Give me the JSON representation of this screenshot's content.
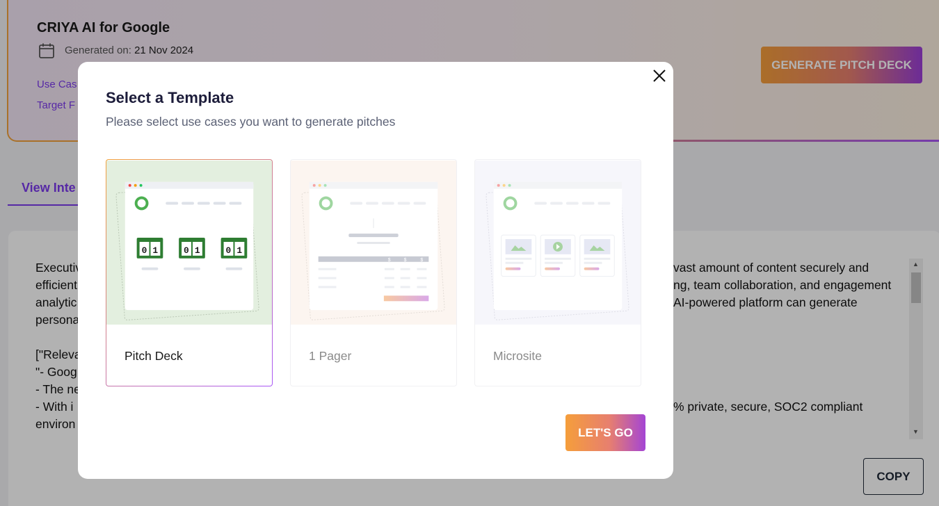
{
  "page": {
    "title": "CRIYA AI for Google",
    "generated_label": "Generated on:",
    "generated_date": "21 Nov 2024",
    "links": [
      "Use Cas",
      "Target F"
    ],
    "generate_button": "GENERATE PITCH DECK",
    "tab_label": "View Inte",
    "copy_button": "COPY",
    "content_lines": [
      {
        "left": "Executiv",
        "right": "vast amount of content securely and"
      },
      {
        "left": "efficient",
        "right": "ng, team collaboration, and engagement"
      },
      {
        "left": "analytic",
        "right": "AI-powered platform can generate"
      },
      {
        "left": "personal",
        "right": ""
      },
      {
        "left": "",
        "right": ""
      },
      {
        "left": "[\"Releva",
        "right": ""
      },
      {
        "left": "\"- Goog",
        "right": ""
      },
      {
        "left": "- The ne",
        "right": ""
      },
      {
        "left": "- With i",
        "right": "% private, secure, SOC2 compliant"
      },
      {
        "left": "environ",
        "right": ""
      }
    ]
  },
  "modal": {
    "title": "Select a Template",
    "subtitle": "Please select use cases you want to generate pitches",
    "templates": [
      {
        "label": "Pitch Deck",
        "selected": true
      },
      {
        "label": "1 Pager",
        "selected": false
      },
      {
        "label": "Microsite",
        "selected": false
      }
    ],
    "go_button": "LET'S GO"
  },
  "colors": {
    "accent_purple": "#7c3aed",
    "gradient_start": "#f59e3b",
    "gradient_end": "#a855f7"
  }
}
